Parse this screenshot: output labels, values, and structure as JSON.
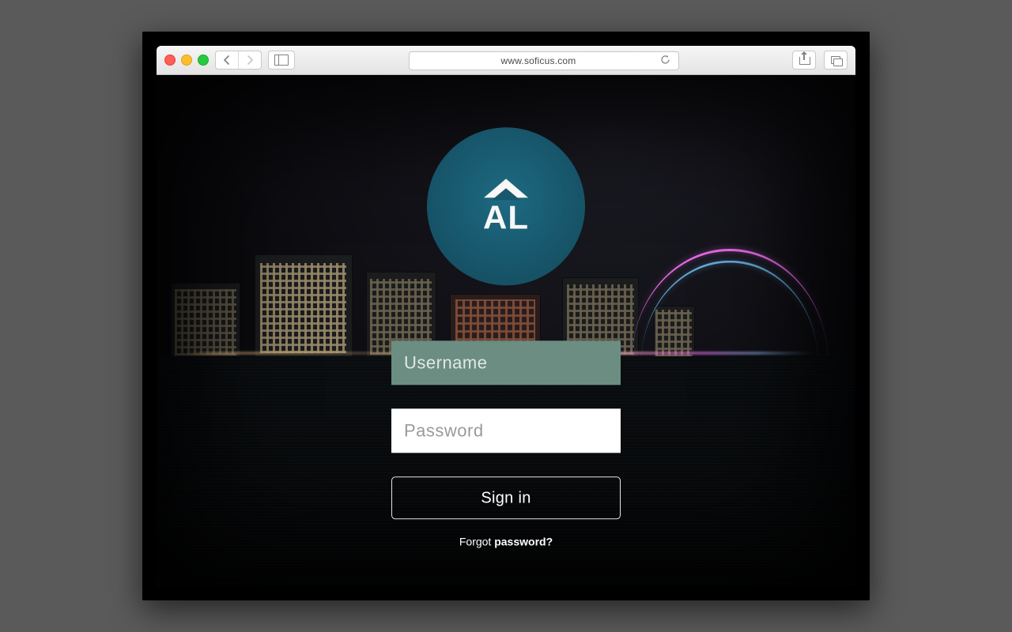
{
  "browser": {
    "url": "www.soficus.com"
  },
  "logo": {
    "text": "AL",
    "bg_color": "#195a70"
  },
  "login": {
    "username_placeholder": "Username",
    "username_value": "",
    "password_placeholder": "Password",
    "password_value": "",
    "signin_label": "Sign in",
    "forgot_prefix": "Forgot ",
    "forgot_bold": "password?"
  }
}
